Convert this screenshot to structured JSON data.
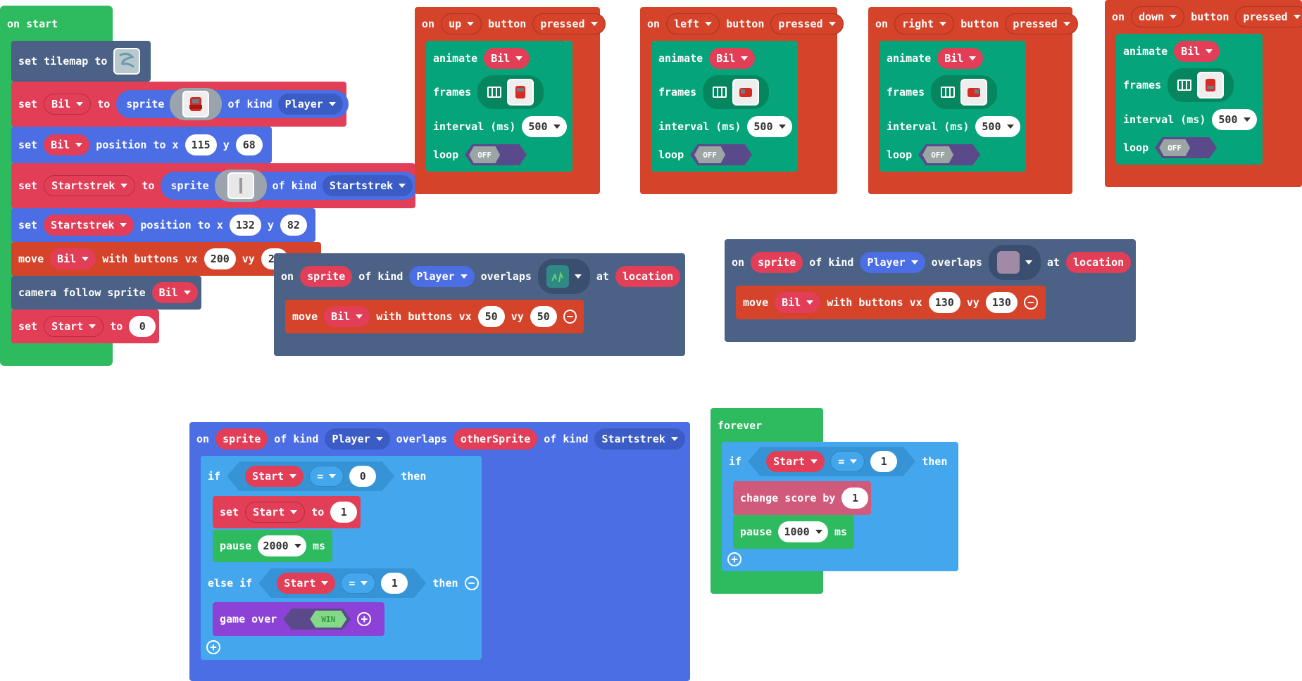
{
  "on_start": {
    "hat": "on start",
    "set_tilemap": {
      "kw": "set tilemap to"
    },
    "set_bil": {
      "set": "set",
      "var": "Bil",
      "to": "to",
      "sprite": "sprite",
      "of_kind": "of kind",
      "kind": "Player"
    },
    "pos_bil": {
      "set": "set",
      "var": "Bil",
      "label": "position to x",
      "x": "115",
      "y_label": "y",
      "y": "68"
    },
    "set_start_strek": {
      "set": "set",
      "var": "Startstrek",
      "to": "to",
      "sprite": "sprite",
      "of_kind": "of kind",
      "kind": "Startstrek"
    },
    "pos_start_strek": {
      "set": "set",
      "var": "Startstrek",
      "label": "position to x",
      "x": "132",
      "y_label": "y",
      "y": "82"
    },
    "move_bil": {
      "move": "move",
      "var": "Bil",
      "with": "with buttons vx",
      "vx": "200",
      "vy_label": "vy",
      "vy": "20"
    },
    "camera": {
      "label": "camera follow sprite",
      "var": "Bil"
    },
    "set_start": {
      "set": "set",
      "var": "Start",
      "to": "to",
      "val": "0"
    }
  },
  "button_events": [
    {
      "on": "on",
      "dir": "up",
      "button": "button",
      "state": "pressed",
      "animate": "animate",
      "var": "Bil",
      "frames": "frames",
      "interval_label": "interval (ms)",
      "interval": "500",
      "loop": "loop",
      "loop_val": "OFF"
    },
    {
      "on": "on",
      "dir": "left",
      "button": "button",
      "state": "pressed",
      "animate": "animate",
      "var": "Bil",
      "frames": "frames",
      "interval_label": "interval (ms)",
      "interval": "500",
      "loop": "loop",
      "loop_val": "OFF"
    },
    {
      "on": "on",
      "dir": "right",
      "button": "button",
      "state": "pressed",
      "animate": "animate",
      "var": "Bil",
      "frames": "frames",
      "interval_label": "interval (ms)",
      "interval": "500",
      "loop": "loop",
      "loop_val": "OFF"
    },
    {
      "on": "on",
      "dir": "down",
      "button": "button",
      "state": "pressed",
      "animate": "animate",
      "var": "Bil",
      "frames": "frames",
      "interval_label": "interval (ms)",
      "interval": "500",
      "loop": "loop",
      "loop_val": "OFF"
    }
  ],
  "overlap_tile_1": {
    "on": "on",
    "sprite": "sprite",
    "of_kind": "of kind",
    "kind": "Player",
    "overlaps": "overlaps",
    "at": "at",
    "location": "location",
    "move": "move",
    "var": "Bil",
    "with": "with buttons vx",
    "vx": "50",
    "vy_label": "vy",
    "vy": "50"
  },
  "overlap_tile_2": {
    "on": "on",
    "sprite": "sprite",
    "of_kind": "of kind",
    "kind": "Player",
    "overlaps": "overlaps",
    "at": "at",
    "location": "location",
    "move": "move",
    "var": "Bil",
    "with": "with buttons vx",
    "vx": "130",
    "vy_label": "vy",
    "vy": "130"
  },
  "overlap_sprite": {
    "on": "on",
    "sprite": "sprite",
    "of_kind": "of kind",
    "kind": "Player",
    "overlaps": "overlaps",
    "other": "otherSprite",
    "of_kind2": "of kind",
    "kind2": "Startstrek",
    "if": "if",
    "cond_var": "Start",
    "op": "=",
    "cond_val": "0",
    "then": "then",
    "set": "set",
    "set_var": "Start",
    "to": "to",
    "set_val": "1",
    "pause": "pause",
    "pause_val": "2000",
    "ms": "ms",
    "else_if": "else if",
    "cond2_var": "Start",
    "op2": "=",
    "cond2_val": "1",
    "then2": "then",
    "game_over": "game over",
    "win": "WIN"
  },
  "forever": {
    "hat": "forever",
    "if": "if",
    "cond_var": "Start",
    "op": "=",
    "cond_val": "1",
    "then": "then",
    "change_score": "change score by",
    "score_val": "1",
    "pause": "pause",
    "pause_val": "1000",
    "ms": "ms"
  },
  "colors": {
    "events": "#d4432a",
    "sprites": "#4b6ee5",
    "variables": "#e23e57",
    "loops": "#2eba5f",
    "logic": "#44a7ee",
    "animation": "#06a47a",
    "scene": "#4b6185",
    "info": "#cf5a7c",
    "game": "#8c42d6"
  }
}
